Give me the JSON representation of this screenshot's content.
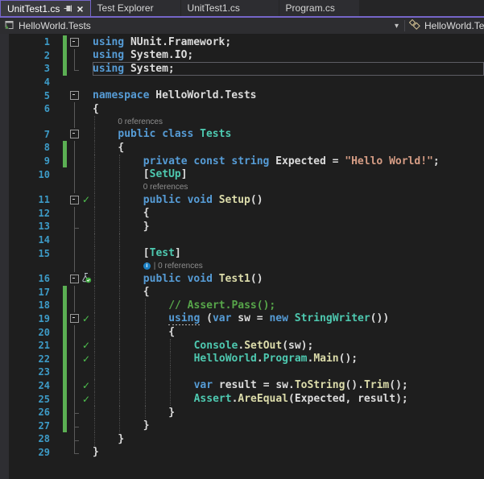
{
  "colors": {
    "accent_purple": "#7565C8",
    "editor_bg": "#1e1e1e",
    "change_bar_green": "#5BAF53",
    "test_pass_green": "#4FC24F",
    "line_number_blue": "#3D9BC7",
    "keyword_blue": "#569CD6",
    "type_teal": "#4EC9B0",
    "method_yellow": "#DCDCAA",
    "string_orange": "#D69D85",
    "comment_green": "#57A64A"
  },
  "icons": {
    "close": "×",
    "dropdown_arrow": "▾",
    "check": "✓",
    "info": "i",
    "pin": "pin-icon",
    "test_project": "test-project-icon",
    "member_class": "class-icon",
    "beaker": "test-beaker-icon"
  },
  "tabs": [
    {
      "label": "UnitTest1.cs",
      "active": true,
      "has_pin": true,
      "has_close": true
    },
    {
      "label": "Test Explorer",
      "active": false
    },
    {
      "label": "UnitTest1.cs",
      "active": false
    },
    {
      "label": "Program.cs",
      "active": false
    }
  ],
  "navbar": {
    "project_label": "HelloWorld.Tests",
    "member_label": "HelloWorld.Te"
  },
  "editor": {
    "codelens_label": "0 references",
    "rows": [
      {
        "t": "c",
        "n": 1,
        "i": 0,
        "g": 0,
        "chg": 1,
        "f": "box",
        "tokens": [
          [
            "kw",
            "using"
          ],
          [
            "pl",
            " NUnit.Framework;"
          ]
        ]
      },
      {
        "t": "c",
        "n": 2,
        "i": 0,
        "g": 0,
        "chg": 1,
        "f": "line",
        "tokens": [
          [
            "kw",
            "using"
          ],
          [
            "pl",
            " System.IO;"
          ]
        ]
      },
      {
        "t": "c",
        "n": 3,
        "i": 0,
        "g": 0,
        "chg": 1,
        "f": "corner",
        "cur": 1,
        "tokens": [
          [
            "kw",
            "using"
          ],
          [
            "pl",
            " System;"
          ]
        ]
      },
      {
        "t": "c",
        "n": 4,
        "i": 0,
        "g": 0,
        "tokens": []
      },
      {
        "t": "c",
        "n": 5,
        "i": 0,
        "g": 0,
        "f": "box",
        "tokens": [
          [
            "kw",
            "namespace"
          ],
          [
            "pl",
            " HelloWorld.Tests"
          ]
        ]
      },
      {
        "t": "c",
        "n": 6,
        "i": 0,
        "g": 0,
        "f": "line",
        "tokens": [
          [
            "pl",
            "{"
          ]
        ]
      },
      {
        "t": "l",
        "i": 1,
        "g": 1,
        "f": "line",
        "text": "0 references"
      },
      {
        "t": "c",
        "n": 7,
        "i": 1,
        "g": 1,
        "f": "box",
        "tokens": [
          [
            "kw",
            "public"
          ],
          [
            "pl",
            " "
          ],
          [
            "kw",
            "class"
          ],
          [
            "pl",
            " "
          ],
          [
            "ty",
            "Tests"
          ]
        ]
      },
      {
        "t": "c",
        "n": 8,
        "i": 1,
        "g": 1,
        "chg": 1,
        "f": "line",
        "tokens": [
          [
            "pl",
            "{"
          ]
        ]
      },
      {
        "t": "c",
        "n": 9,
        "i": 2,
        "g": 2,
        "chg": 1,
        "f": "line",
        "tokens": [
          [
            "kw",
            "private"
          ],
          [
            "pl",
            " "
          ],
          [
            "kw",
            "const"
          ],
          [
            "pl",
            " "
          ],
          [
            "kw",
            "string"
          ],
          [
            "pl",
            " Expected = "
          ],
          [
            "str",
            "\"Hello World!\""
          ],
          [
            "pl",
            ";"
          ]
        ]
      },
      {
        "t": "c",
        "n": 10,
        "i": 2,
        "g": 2,
        "f": "line",
        "tokens": [
          [
            "pl",
            "["
          ],
          [
            "ty",
            "SetUp"
          ],
          [
            "pl",
            "]"
          ]
        ]
      },
      {
        "t": "l",
        "i": 2,
        "g": 2,
        "f": "line",
        "text": "0 references"
      },
      {
        "t": "c",
        "n": 11,
        "i": 2,
        "g": 2,
        "f": "box",
        "test": "check",
        "tokens": [
          [
            "kw",
            "public"
          ],
          [
            "pl",
            " "
          ],
          [
            "kw",
            "void"
          ],
          [
            "pl",
            " "
          ],
          [
            "mth",
            "Setup"
          ],
          [
            "pl",
            "()"
          ]
        ]
      },
      {
        "t": "c",
        "n": 12,
        "i": 2,
        "g": 2,
        "f": "line",
        "tokens": [
          [
            "pl",
            "{"
          ]
        ]
      },
      {
        "t": "c",
        "n": 13,
        "i": 2,
        "g": 2,
        "f": "cornerline",
        "tokens": [
          [
            "pl",
            "}"
          ]
        ]
      },
      {
        "t": "c",
        "n": 14,
        "i": 2,
        "g": 2,
        "f": "line",
        "tokens": []
      },
      {
        "t": "c",
        "n": 15,
        "i": 2,
        "g": 2,
        "f": "line",
        "tokens": [
          [
            "pl",
            "["
          ],
          [
            "ty",
            "Test"
          ],
          [
            "pl",
            "]"
          ]
        ]
      },
      {
        "t": "l",
        "i": 2,
        "g": 2,
        "f": "line",
        "info": 1,
        "text": "| 0 references"
      },
      {
        "t": "c",
        "n": 16,
        "i": 2,
        "g": 2,
        "f": "box",
        "test": "beaker",
        "tokens": [
          [
            "kw",
            "public"
          ],
          [
            "pl",
            " "
          ],
          [
            "kw",
            "void"
          ],
          [
            "pl",
            " "
          ],
          [
            "mth",
            "Test1"
          ],
          [
            "pl",
            "()"
          ]
        ]
      },
      {
        "t": "c",
        "n": 17,
        "i": 2,
        "g": 2,
        "chg": 1,
        "f": "line",
        "tokens": [
          [
            "pl",
            "{"
          ]
        ]
      },
      {
        "t": "c",
        "n": 18,
        "i": 3,
        "g": 3,
        "chg": 1,
        "f": "line",
        "tokens": [
          [
            "com",
            "// Assert.Pass();"
          ]
        ]
      },
      {
        "t": "c",
        "n": 19,
        "i": 3,
        "g": 3,
        "chg": 1,
        "f": "box",
        "test": "check",
        "tokens": [
          [
            "kwu",
            "using"
          ],
          [
            "pl",
            " ("
          ],
          [
            "kw",
            "var"
          ],
          [
            "pl",
            " sw = "
          ],
          [
            "kw",
            "new"
          ],
          [
            "pl",
            " "
          ],
          [
            "ty",
            "StringWriter"
          ],
          [
            "pl",
            "())"
          ]
        ]
      },
      {
        "t": "c",
        "n": 20,
        "i": 3,
        "g": 3,
        "chg": 1,
        "f": "line",
        "tokens": [
          [
            "pl",
            "{"
          ]
        ]
      },
      {
        "t": "c",
        "n": 21,
        "i": 4,
        "g": 4,
        "chg": 1,
        "f": "line",
        "test": "check",
        "tokens": [
          [
            "ty",
            "Console"
          ],
          [
            "pl",
            "."
          ],
          [
            "mth",
            "SetOut"
          ],
          [
            "pl",
            "(sw);"
          ]
        ]
      },
      {
        "t": "c",
        "n": 22,
        "i": 4,
        "g": 4,
        "chg": 1,
        "f": "line",
        "test": "check",
        "tokens": [
          [
            "ty",
            "HelloWorld"
          ],
          [
            "pl",
            "."
          ],
          [
            "ty",
            "Program"
          ],
          [
            "pl",
            "."
          ],
          [
            "mth",
            "Main"
          ],
          [
            "pl",
            "();"
          ]
        ]
      },
      {
        "t": "c",
        "n": 23,
        "i": 4,
        "g": 4,
        "chg": 1,
        "f": "line",
        "tokens": []
      },
      {
        "t": "c",
        "n": 24,
        "i": 4,
        "g": 4,
        "chg": 1,
        "f": "line",
        "test": "check",
        "tokens": [
          [
            "kw",
            "var"
          ],
          [
            "pl",
            " result = sw."
          ],
          [
            "mth",
            "ToString"
          ],
          [
            "pl",
            "()."
          ],
          [
            "mth",
            "Trim"
          ],
          [
            "pl",
            "();"
          ]
        ]
      },
      {
        "t": "c",
        "n": 25,
        "i": 4,
        "g": 4,
        "chg": 1,
        "f": "line",
        "test": "check",
        "tokens": [
          [
            "ty",
            "Assert"
          ],
          [
            "pl",
            "."
          ],
          [
            "mth",
            "AreEqual"
          ],
          [
            "pl",
            "(Expected, result);"
          ]
        ]
      },
      {
        "t": "c",
        "n": 26,
        "i": 3,
        "g": 3,
        "chg": 1,
        "f": "cornerline",
        "tokens": [
          [
            "pl",
            "}"
          ]
        ]
      },
      {
        "t": "c",
        "n": 27,
        "i": 2,
        "g": 2,
        "chg": 1,
        "f": "cornerline",
        "tokens": [
          [
            "pl",
            "}"
          ]
        ]
      },
      {
        "t": "c",
        "n": 28,
        "i": 1,
        "g": 1,
        "f": "cornerline",
        "tokens": [
          [
            "pl",
            "}"
          ]
        ]
      },
      {
        "t": "c",
        "n": 29,
        "i": 0,
        "g": 0,
        "f": "corner",
        "tokens": [
          [
            "pl",
            "}"
          ]
        ]
      }
    ]
  }
}
